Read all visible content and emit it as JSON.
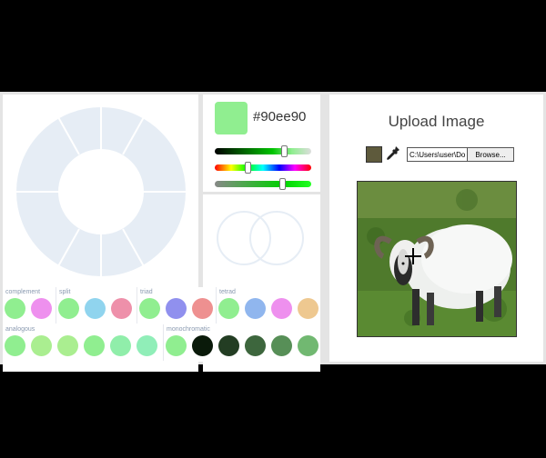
{
  "picker": {
    "hex": "#90ee90",
    "swatch_color": "#90ee90"
  },
  "sliders": {
    "saturation_level": 0.74,
    "hue_level": 0.33,
    "lightness_level": 0.72
  },
  "schemes": {
    "complement": {
      "label": "complement",
      "colors": [
        "#90ee90",
        "#ee90ee"
      ]
    },
    "split": {
      "label": "split",
      "colors": [
        "#90ee90",
        "#90d4ee",
        "#ee90aa"
      ]
    },
    "triad": {
      "label": "triad",
      "colors": [
        "#90ee90",
        "#9090ee",
        "#ee9090"
      ]
    },
    "tetrad": {
      "label": "tetrad",
      "colors": [
        "#90ee90",
        "#90b6ee",
        "#ee90ee",
        "#eec890"
      ]
    },
    "analogous": {
      "label": "analogous",
      "colors": [
        "#90ee90",
        "#aaee90",
        "#aaee90",
        "#90ee90",
        "#90eeaa",
        "#90eeb8"
      ]
    },
    "monochromatic": {
      "label": "monochromatic",
      "colors": [
        "#90ee90",
        "#0a1a0a",
        "#233d23",
        "#3d663d",
        "#578f57",
        "#71b871"
      ]
    }
  },
  "upload": {
    "title": "Upload Image",
    "picked_color": "#5e5a3c",
    "file_path": "C:\\Users\\user\\Do",
    "browse_label": "Browse..."
  }
}
